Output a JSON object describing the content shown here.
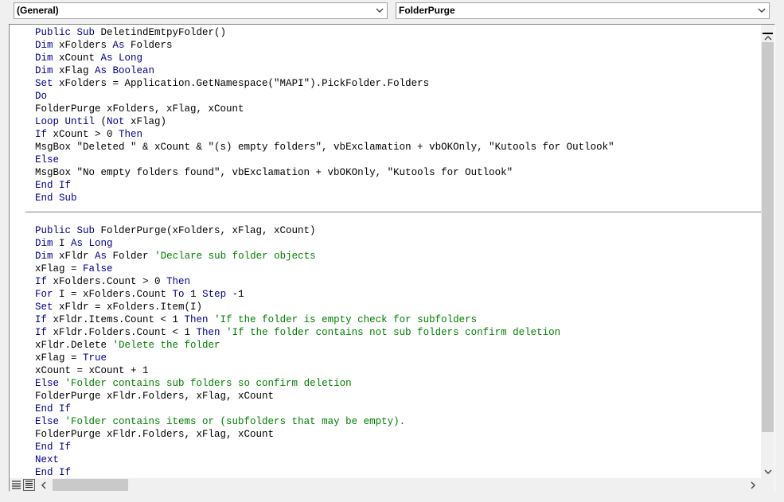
{
  "toolbar": {
    "procedure_combo": "(General)",
    "object_combo": "FolderPurge"
  },
  "colors": {
    "keyword": "#00008b",
    "comment": "#008000",
    "text": "#000000"
  },
  "code": {
    "section1": [
      [
        {
          "t": "Public Sub ",
          "c": "kw"
        },
        {
          "t": "DeletindEmtpyFolder()",
          "c": ""
        }
      ],
      [
        {
          "t": "Dim ",
          "c": "kw"
        },
        {
          "t": "xFolders ",
          "c": ""
        },
        {
          "t": "As ",
          "c": "kw"
        },
        {
          "t": "Folders",
          "c": ""
        }
      ],
      [
        {
          "t": "Dim ",
          "c": "kw"
        },
        {
          "t": "xCount ",
          "c": ""
        },
        {
          "t": "As Long",
          "c": "kw"
        }
      ],
      [
        {
          "t": "Dim ",
          "c": "kw"
        },
        {
          "t": "xFlag ",
          "c": ""
        },
        {
          "t": "As Boolean",
          "c": "kw"
        }
      ],
      [
        {
          "t": "Set ",
          "c": "kw"
        },
        {
          "t": "xFolders = Application.GetNamespace(\"MAPI\").PickFolder.Folders",
          "c": ""
        }
      ],
      [
        {
          "t": "Do",
          "c": "kw"
        }
      ],
      [
        {
          "t": "FolderPurge xFolders, xFlag, xCount",
          "c": ""
        }
      ],
      [
        {
          "t": "Loop Until ",
          "c": "kw"
        },
        {
          "t": "(",
          "c": ""
        },
        {
          "t": "Not ",
          "c": "kw"
        },
        {
          "t": "xFlag)",
          "c": ""
        }
      ],
      [
        {
          "t": "If ",
          "c": "kw"
        },
        {
          "t": "xCount > 0 ",
          "c": ""
        },
        {
          "t": "Then",
          "c": "kw"
        }
      ],
      [
        {
          "t": "MsgBox \"Deleted \" & xCount & \"(s) empty folders\", vbExclamation + vbOKOnly, \"Kutools for Outlook\"",
          "c": ""
        }
      ],
      [
        {
          "t": "Else",
          "c": "kw"
        }
      ],
      [
        {
          "t": "MsgBox \"No empty folders found\", vbExclamation + vbOKOnly, \"Kutools for Outlook\"",
          "c": ""
        }
      ],
      [
        {
          "t": "End If",
          "c": "kw"
        }
      ],
      [
        {
          "t": "End Sub",
          "c": "kw"
        }
      ]
    ],
    "section2": [
      [
        {
          "t": "Public Sub ",
          "c": "kw"
        },
        {
          "t": "FolderPurge(xFolders, xFlag, xCount)",
          "c": ""
        }
      ],
      [
        {
          "t": "Dim ",
          "c": "kw"
        },
        {
          "t": "I ",
          "c": ""
        },
        {
          "t": "As Long",
          "c": "kw"
        }
      ],
      [
        {
          "t": "Dim ",
          "c": "kw"
        },
        {
          "t": "xFldr ",
          "c": ""
        },
        {
          "t": "As ",
          "c": "kw"
        },
        {
          "t": "Folder ",
          "c": ""
        },
        {
          "t": "'Declare sub folder objects",
          "c": "cm"
        }
      ],
      [
        {
          "t": "xFlag = ",
          "c": ""
        },
        {
          "t": "False",
          "c": "kw"
        }
      ],
      [
        {
          "t": "If ",
          "c": "kw"
        },
        {
          "t": "xFolders.Count > 0 ",
          "c": ""
        },
        {
          "t": "Then",
          "c": "kw"
        }
      ],
      [
        {
          "t": "For ",
          "c": "kw"
        },
        {
          "t": "I = xFolders.Count ",
          "c": ""
        },
        {
          "t": "To ",
          "c": "kw"
        },
        {
          "t": "1 ",
          "c": ""
        },
        {
          "t": "Step ",
          "c": "kw"
        },
        {
          "t": "-1",
          "c": ""
        }
      ],
      [
        {
          "t": "Set ",
          "c": "kw"
        },
        {
          "t": "xFldr = xFolders.Item(I)",
          "c": ""
        }
      ],
      [
        {
          "t": "If ",
          "c": "kw"
        },
        {
          "t": "xFldr.Items.Count < 1 ",
          "c": ""
        },
        {
          "t": "Then ",
          "c": "kw"
        },
        {
          "t": "'If the folder is empty check for subfolders",
          "c": "cm"
        }
      ],
      [
        {
          "t": "If ",
          "c": "kw"
        },
        {
          "t": "xFldr.Folders.Count < 1 ",
          "c": ""
        },
        {
          "t": "Then ",
          "c": "kw"
        },
        {
          "t": "'If the folder contains not sub folders confirm deletion",
          "c": "cm"
        }
      ],
      [
        {
          "t": "xFldr.Delete ",
          "c": ""
        },
        {
          "t": "'Delete the folder",
          "c": "cm"
        }
      ],
      [
        {
          "t": "xFlag = ",
          "c": ""
        },
        {
          "t": "True",
          "c": "kw"
        }
      ],
      [
        {
          "t": "xCount = xCount + 1",
          "c": ""
        }
      ],
      [
        {
          "t": "Else ",
          "c": "kw"
        },
        {
          "t": "'Folder contains sub folders so confirm deletion",
          "c": "cm"
        }
      ],
      [
        {
          "t": "FolderPurge xFldr.Folders, xFlag, xCount",
          "c": ""
        }
      ],
      [
        {
          "t": "End If",
          "c": "kw"
        }
      ],
      [
        {
          "t": "Else ",
          "c": "kw"
        },
        {
          "t": "'Folder contains items or (subfolders that may be empty).",
          "c": "cm"
        }
      ],
      [
        {
          "t": "FolderPurge xFldr.Folders, xFlag, xCount",
          "c": ""
        }
      ],
      [
        {
          "t": "End If",
          "c": "kw"
        }
      ],
      [
        {
          "t": "Next",
          "c": "kw"
        }
      ],
      [
        {
          "t": "End If",
          "c": "kw"
        }
      ]
    ]
  },
  "icons": {
    "combo_arrow": "chevron-down-icon",
    "scroll_up": "chevron-up-icon",
    "scroll_down": "chevron-down-icon",
    "scroll_left": "chevron-left-icon",
    "scroll_right": "chevron-right-icon",
    "procedure_view": "procedure-view-icon",
    "full_module_view": "full-module-view-icon"
  }
}
